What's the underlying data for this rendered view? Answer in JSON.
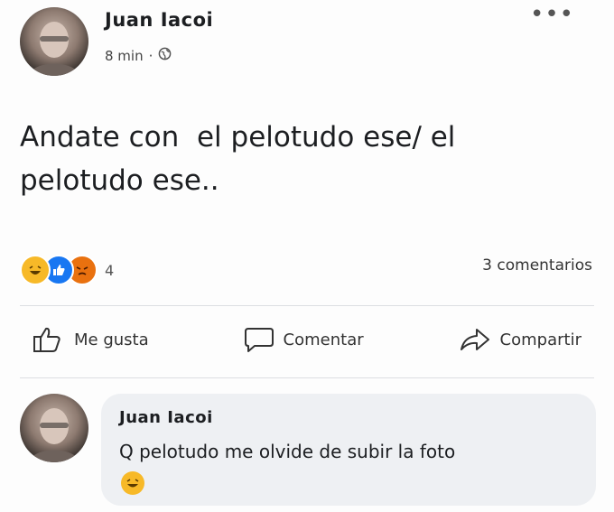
{
  "post": {
    "author": "Juan Iacoi",
    "time": "8 min",
    "separator": "·",
    "privacy_icon": "globe-icon",
    "more_icon": "•••",
    "text": "Andate con  el pelotudo ese/ el\npelotudo ese..",
    "reactions": {
      "icons": [
        "haha-reaction-icon",
        "like-reaction-icon",
        "angry-reaction-icon"
      ],
      "count": "4"
    },
    "comment_count": "3 comentarios"
  },
  "actions": {
    "like": "Me gusta",
    "comment": "Comentar",
    "share": "Compartir"
  },
  "comment": {
    "author": "Juan Iacoi",
    "text": "Q pelotudo me olvide de subir la foto",
    "emoji": "😂"
  },
  "colors": {
    "like_blue": "#1877f2",
    "haha_yellow": "#f7b928",
    "angry_orange": "#e9710f",
    "bubble_bg": "#eef0f3"
  }
}
